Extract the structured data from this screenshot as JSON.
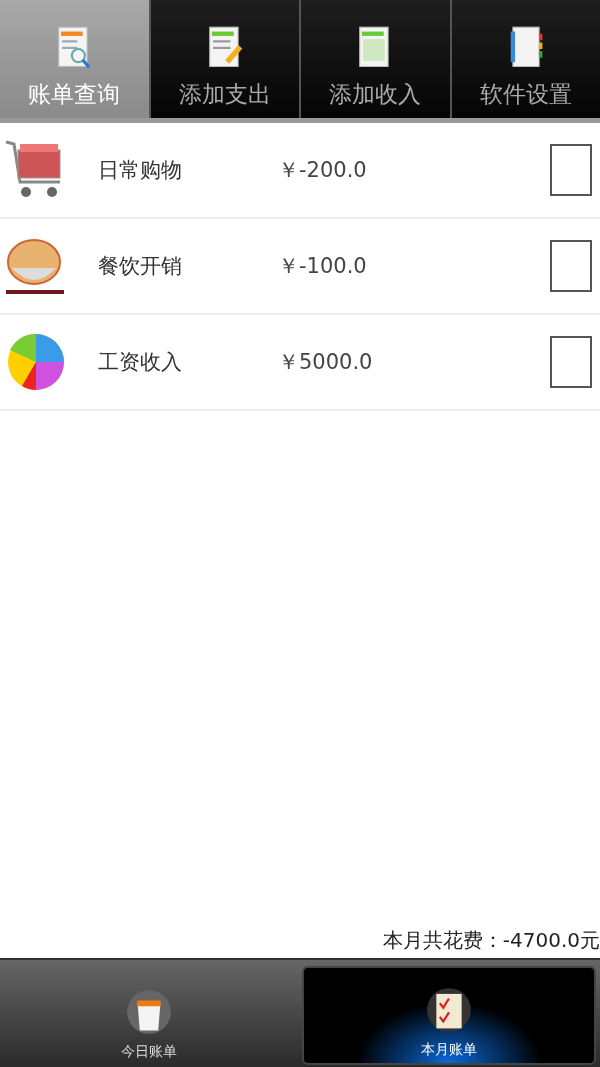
{
  "tabs": [
    {
      "label": "账单查询",
      "selected": true,
      "kind": "search"
    },
    {
      "label": "添加支出",
      "selected": false,
      "kind": "edit"
    },
    {
      "label": "添加收入",
      "selected": false,
      "kind": "sheet"
    },
    {
      "label": "软件设置",
      "selected": false,
      "kind": "book"
    }
  ],
  "records": [
    {
      "kind": "cart",
      "name": "日常购物",
      "amount": "￥-200.0",
      "checked": false
    },
    {
      "kind": "bowl",
      "name": "餐饮开销",
      "amount": "￥-100.0",
      "checked": false
    },
    {
      "kind": "pie",
      "name": "工资收入",
      "amount": "￥5000.0",
      "checked": false
    }
  ],
  "summary": "本月共花费：-4700.0元",
  "bottom_tabs": [
    {
      "label": "今日账单",
      "selected": false,
      "kind": "bag"
    },
    {
      "label": "本月账单",
      "selected": true,
      "kind": "checklist"
    }
  ]
}
